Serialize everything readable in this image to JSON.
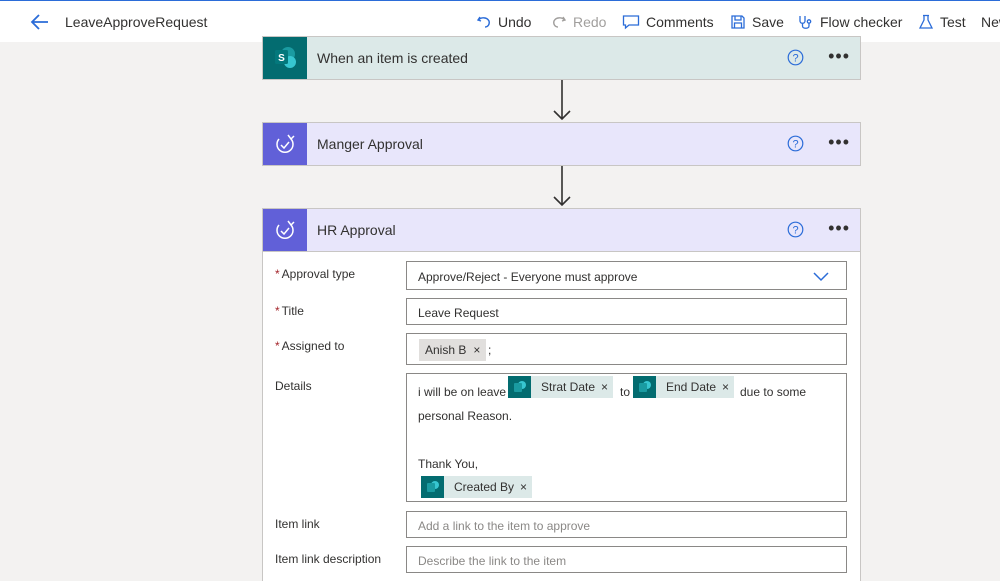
{
  "header": {
    "flow_name": "LeaveApproveRequest",
    "undo": "Undo",
    "redo": "Redo",
    "comments": "Comments",
    "save": "Save",
    "flow_checker": "Flow checker",
    "test": "Test",
    "new": "New"
  },
  "steps": {
    "trigger": {
      "title": "When an item is created",
      "icon_letter": "S"
    },
    "manager": {
      "title": "Manger Approval"
    },
    "hr": {
      "title": "HR Approval"
    }
  },
  "form": {
    "approval_type": {
      "label": "Approval type",
      "value": "Approve/Reject - Everyone must approve"
    },
    "title": {
      "label": "Title",
      "value": "Leave Request"
    },
    "assigned_to": {
      "label": "Assigned to",
      "person": "Anish B",
      "separator": ";"
    },
    "details": {
      "label": "Details",
      "text1": "i will be on leave",
      "token1": "Strat Date",
      "text2": "to",
      "token2": "End Date",
      "text3": "due to some",
      "line2": "personal Reason.",
      "line3": "Thank You,",
      "token3": "Created By"
    },
    "item_link": {
      "label": "Item link",
      "placeholder": "Add a link to the item to approve"
    },
    "item_link_desc": {
      "label": "Item link description",
      "placeholder": "Describe the link to the item"
    }
  },
  "colors": {
    "accent": "#2b6cd8",
    "sharepoint": "#036c70",
    "approval": "#6160d8",
    "required": "#a4262c"
  }
}
